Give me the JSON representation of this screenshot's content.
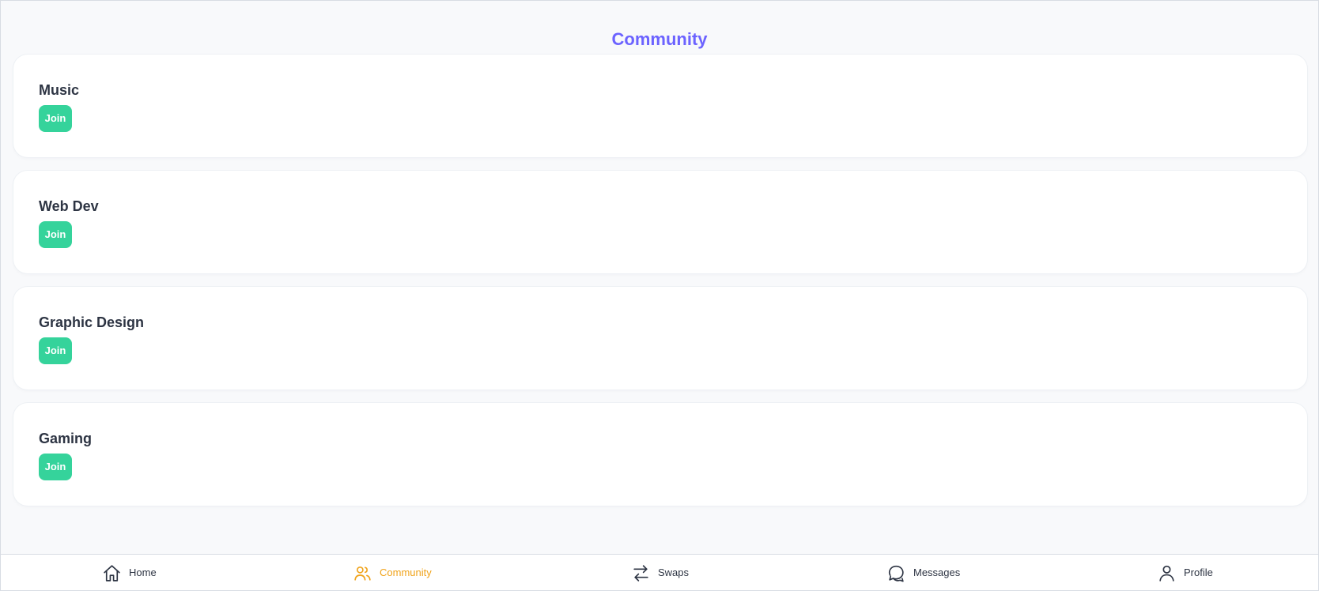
{
  "page": {
    "title": "Community"
  },
  "groups": [
    {
      "name": "Music",
      "action": "Join"
    },
    {
      "name": "Web Dev",
      "action": "Join"
    },
    {
      "name": "Graphic Design",
      "action": "Join"
    },
    {
      "name": "Gaming",
      "action": "Join"
    }
  ],
  "navigation": {
    "active": "Community",
    "items": [
      {
        "label": "Home",
        "icon": "home-icon"
      },
      {
        "label": "Community",
        "icon": "users-icon"
      },
      {
        "label": "Swaps",
        "icon": "swap-arrows-icon"
      },
      {
        "label": "Messages",
        "icon": "chat-bubbles-icon"
      },
      {
        "label": "Profile",
        "icon": "user-icon"
      }
    ]
  },
  "colors": {
    "background": "#f8f9fb",
    "title": "#6c63ff",
    "text": "#2d3443",
    "join_button": "#35d39b",
    "active_navigation": "#f0a31a"
  }
}
